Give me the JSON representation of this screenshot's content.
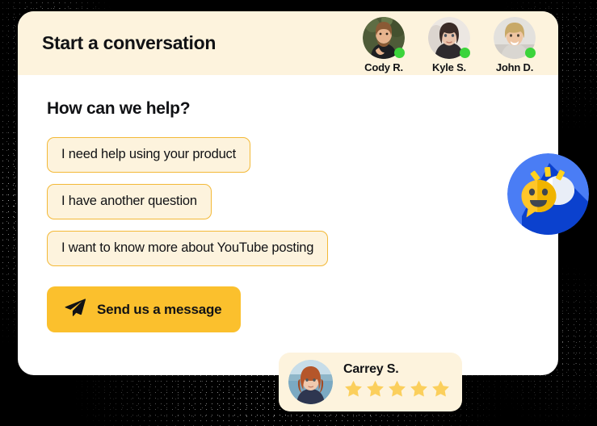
{
  "header": {
    "title": "Start a conversation",
    "agents": [
      {
        "name": "Cody R.",
        "status": "online"
      },
      {
        "name": "Kyle S.",
        "status": "online"
      },
      {
        "name": "John D.",
        "status": "online"
      }
    ]
  },
  "main": {
    "prompt": "How can we help?",
    "options": [
      "I need help using your product",
      "I have another question",
      "I want to know more about YouTube posting"
    ],
    "send_button": {
      "label": "Send us a message",
      "icon": "paper-plane-icon"
    }
  },
  "mascot": {
    "icon": "chat-bubbles-smiley-icon"
  },
  "review": {
    "name": "Carrey S.",
    "rating": 5,
    "max_rating": 5
  },
  "colors": {
    "cream": "#FDF3DD",
    "amber": "#FBC02D",
    "chip_border": "#F3B937",
    "online_green": "#3BD43B",
    "star": "#FBCF5C",
    "mascot_blue": "#4A7DF5",
    "mascot_blue_dark": "#0B41CE",
    "text": "#111215"
  }
}
